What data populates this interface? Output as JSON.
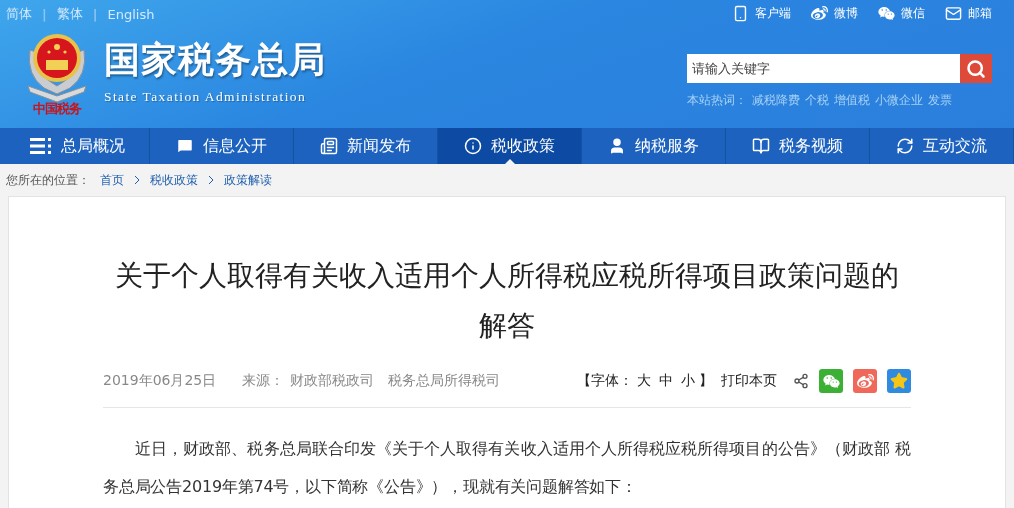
{
  "language_bar": [
    {
      "kind": "link",
      "label": "简体"
    },
    {
      "kind": "separator",
      "label": "|"
    },
    {
      "kind": "link",
      "label": "繁体"
    },
    {
      "kind": "separator",
      "label": "|"
    },
    {
      "kind": "link",
      "label": "English"
    }
  ],
  "site": {
    "title": "国家税务总局",
    "subtitle": "State Taxation Administration",
    "emblem_caption": "中国税务"
  },
  "top_links": [
    {
      "kind": "phone",
      "label": "客户端"
    },
    {
      "kind": "weibo",
      "label": "微博"
    },
    {
      "kind": "wechat",
      "label": "微信"
    },
    {
      "kind": "mail",
      "label": "邮箱"
    }
  ],
  "search": {
    "placeholder": "请输入关键字"
  },
  "hot_words": {
    "label": "本站热词：",
    "items": [
      "减税降费",
      "个税",
      "增值税",
      "小微企业",
      "发票"
    ]
  },
  "nav": [
    {
      "kind": "overview",
      "label": "总局概况",
      "selected": false
    },
    {
      "kind": "info",
      "label": "信息公开",
      "selected": false
    },
    {
      "kind": "news",
      "label": "新闻发布",
      "selected": false
    },
    {
      "kind": "policy",
      "label": "税收政策",
      "selected": true
    },
    {
      "kind": "service",
      "label": "纳税服务",
      "selected": false
    },
    {
      "kind": "video",
      "label": "税务视频",
      "selected": false
    },
    {
      "kind": "exchange",
      "label": "互动交流",
      "selected": false
    }
  ],
  "breadcrumb": {
    "label": "您所在的位置：",
    "items": [
      {
        "label": "首页"
      },
      {
        "label": "税收政策"
      },
      {
        "label": "政策解读"
      }
    ]
  },
  "article": {
    "title": "关于个人取得有关收入适用个人所得税应税所得项目政策问题的解答",
    "date": "2019年06月25日",
    "source_label": "来源：",
    "sources": [
      "财政部税政司",
      "税务总局所得税司"
    ],
    "font_label": "【字体：",
    "font_sizes": [
      "大",
      "中",
      "小"
    ],
    "font_close": "】",
    "print": "打印本页",
    "share": [
      {
        "kind": "share"
      },
      {
        "kind": "wechat"
      },
      {
        "kind": "weibo"
      },
      {
        "kind": "qzone"
      }
    ],
    "paragraphs": [
      "近日，财政部、税务总局联合印发《关于个人取得有关收入适用个人所得税应税所得项目的公告》（财政部 税务总局公告2019年第74号，以下简称《公告》），现就有关问题解答如下："
    ]
  }
}
